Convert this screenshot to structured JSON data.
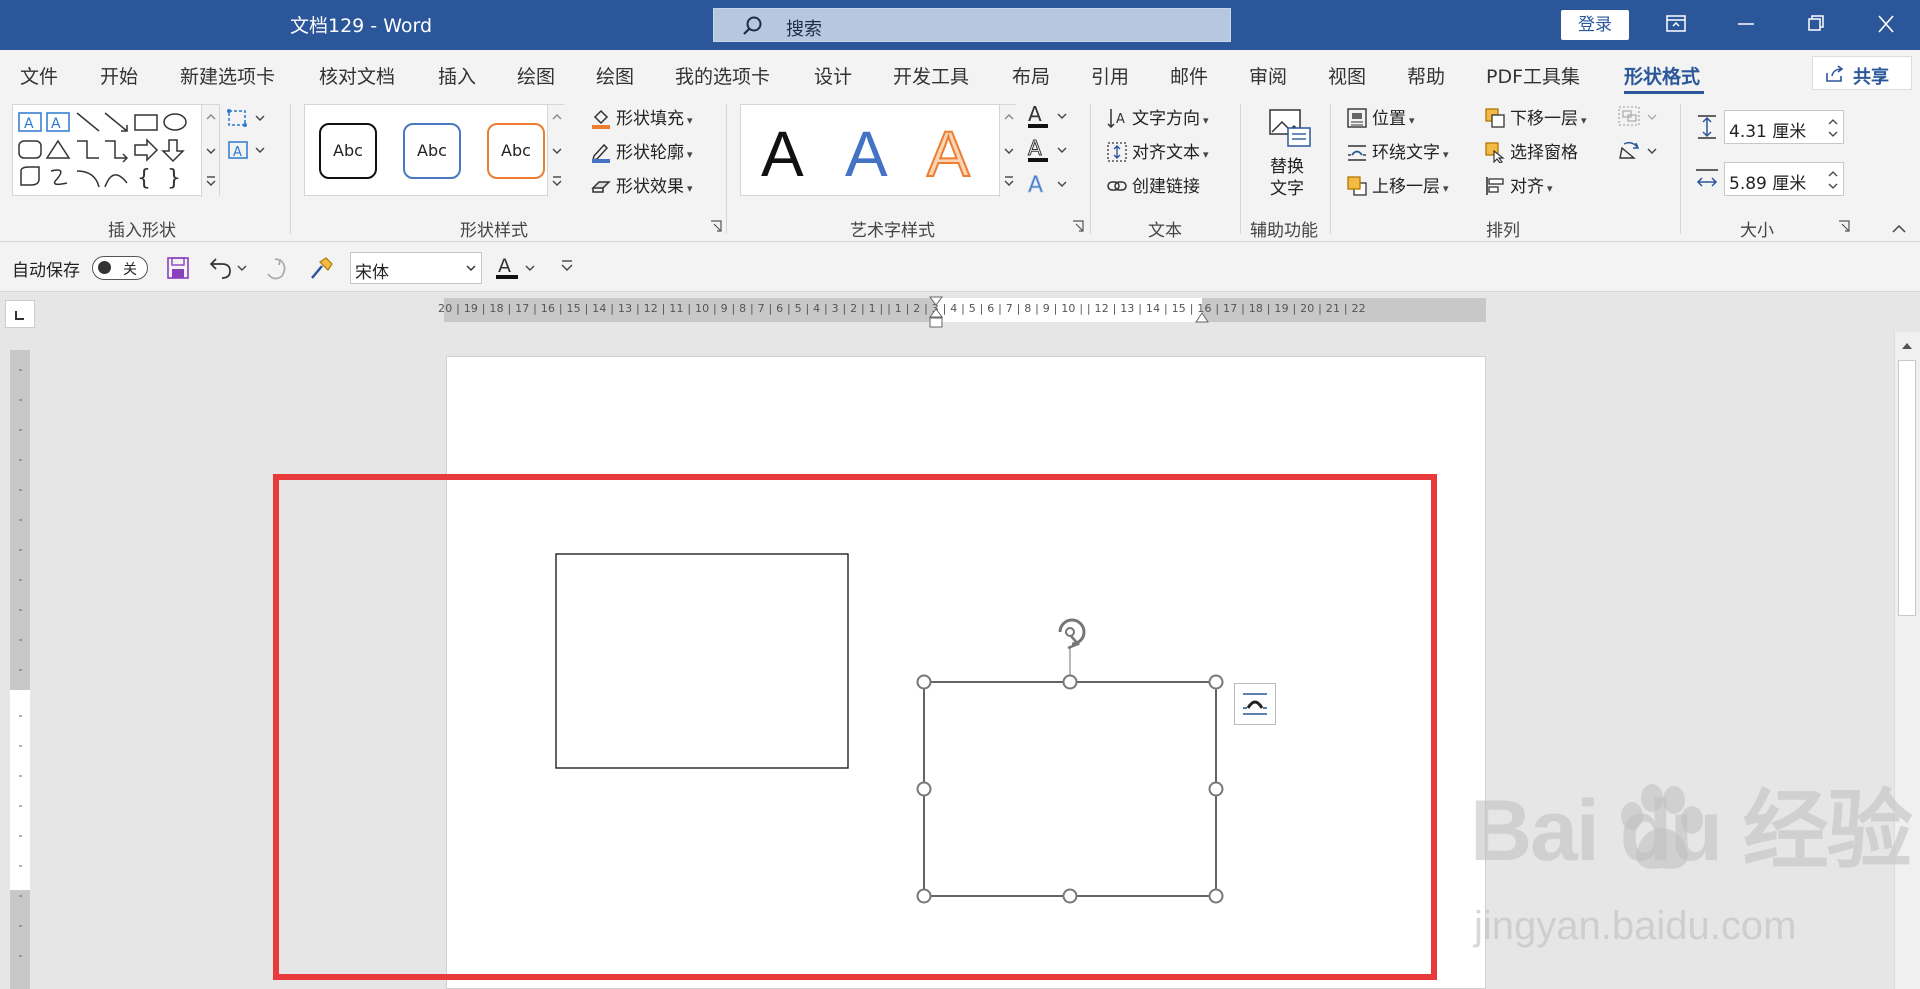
{
  "titlebar": {
    "doc_title": "文档129  -  Word",
    "search_label": "搜索",
    "login_label": "登录",
    "bg_color": "#2b579a"
  },
  "tabs": [
    {
      "label": "文件"
    },
    {
      "label": "开始"
    },
    {
      "label": "新建选项卡"
    },
    {
      "label": "核对文档"
    },
    {
      "label": "插入"
    },
    {
      "label": "绘图"
    },
    {
      "label": "绘图"
    },
    {
      "label": "我的选项卡"
    },
    {
      "label": "设计"
    },
    {
      "label": "开发工具"
    },
    {
      "label": "布局"
    },
    {
      "label": "引用"
    },
    {
      "label": "邮件"
    },
    {
      "label": "审阅"
    },
    {
      "label": "视图"
    },
    {
      "label": "帮助"
    },
    {
      "label": "PDF工具集"
    },
    {
      "label": "形状格式",
      "active": true
    }
  ],
  "share_label": "共享",
  "ribbon": {
    "insert_shapes": {
      "label": "插入形状"
    },
    "shape_styles": {
      "label": "形状样式",
      "samples": [
        "Abc",
        "Abc",
        "Abc"
      ],
      "fill": "形状填充",
      "outline": "形状轮廓",
      "effects": "形状效果"
    },
    "wordart": {
      "label": "艺术字样式",
      "letter": "A"
    },
    "text": {
      "label": "文本",
      "direction": "文字方向",
      "align": "对齐文本",
      "link": "创建链接"
    },
    "accessibility": {
      "label": "辅助功能",
      "alt_text_1": "替换",
      "alt_text_2": "文字"
    },
    "arrange": {
      "label": "排列",
      "position": "位置",
      "wrap": "环绕文字",
      "bring_forward": "上移一层",
      "send_backward": "下移一层",
      "selection_pane": "选择窗格",
      "align": "对齐"
    },
    "size": {
      "label": "大小",
      "height": "4.31 厘米",
      "width": "5.89 厘米"
    }
  },
  "qat": {
    "autosave_label": "自动保存",
    "autosave_state": "关",
    "font_name": "宋体"
  },
  "ruler": {
    "horizontal": "20 | 19 | 18 | 17 | 16 | 15 | 14 | 13 | 12 | 11 | 10 |  9  |  8  |  7  |  6  |  5  |  4  |  3  |  2  |  1  |     |  1  |  2  |  3  |  4  |  5  |  6  |  7  |  8  |  9  | 10 |     | 12 | 13 | 14 | 15 | 16 | 17 | 18 | 19 | 20 | 21 | 22"
  },
  "watermark": {
    "logo": "Bai  du 经验",
    "url": "jingyan.baidu.com"
  },
  "colors": {
    "accent": "#2b579a",
    "highlight_frame": "#e83a3a"
  }
}
